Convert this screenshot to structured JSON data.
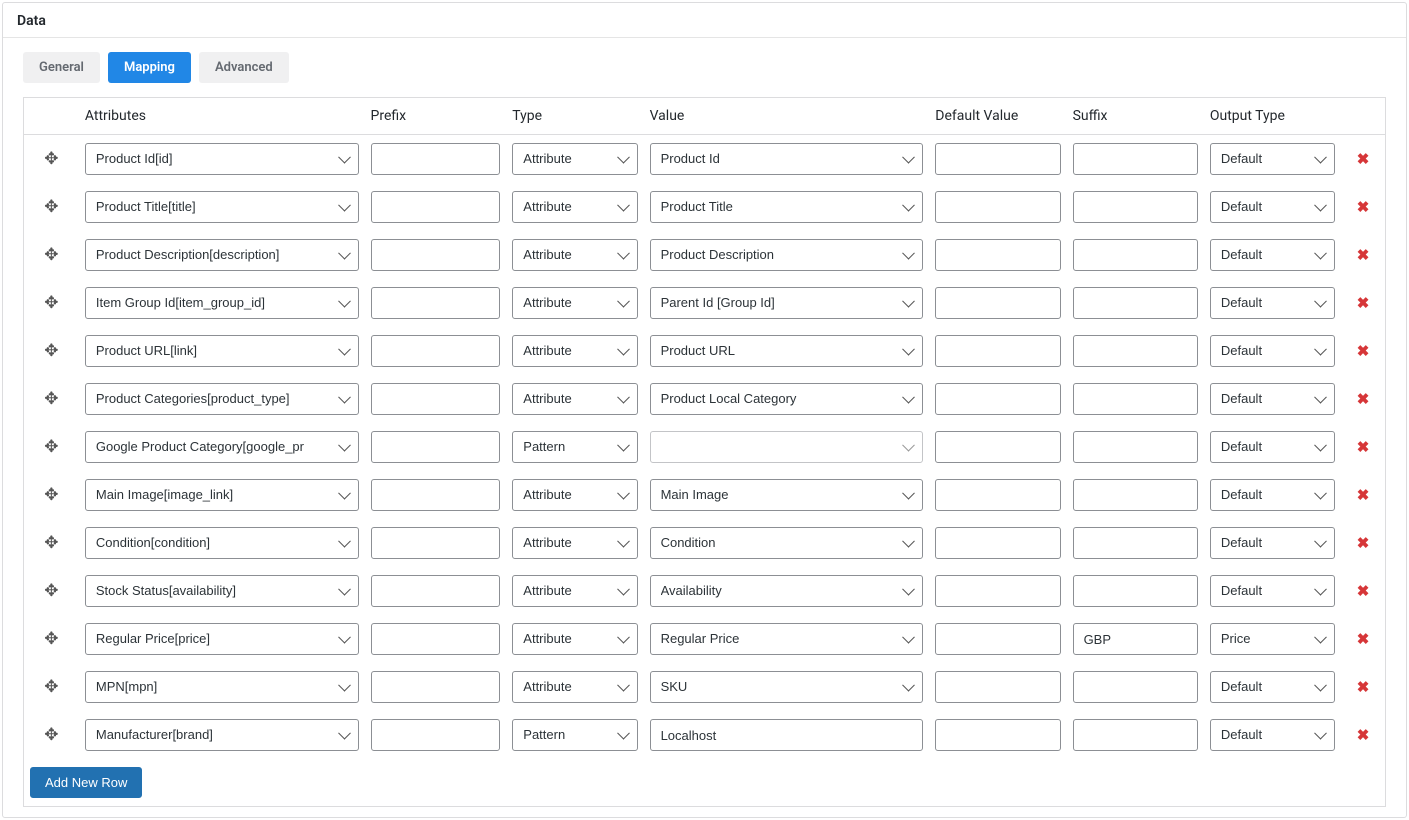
{
  "panel": {
    "title": "Data"
  },
  "tabs": [
    {
      "label": "General",
      "active": false
    },
    {
      "label": "Mapping",
      "active": true
    },
    {
      "label": "Advanced",
      "active": false
    }
  ],
  "headers": {
    "attributes": "Attributes",
    "prefix": "Prefix",
    "type": "Type",
    "value": "Value",
    "default_value": "Default Value",
    "suffix": "Suffix",
    "output_type": "Output Type"
  },
  "rows": [
    {
      "attribute": "Product Id[id]",
      "prefix": "",
      "type": "Attribute",
      "value": "Product Id",
      "value_kind": "select",
      "default": "",
      "suffix": "",
      "output": "Default"
    },
    {
      "attribute": "Product Title[title]",
      "prefix": "",
      "type": "Attribute",
      "value": "Product Title",
      "value_kind": "select",
      "default": "",
      "suffix": "",
      "output": "Default"
    },
    {
      "attribute": "Product Description[description]",
      "prefix": "",
      "type": "Attribute",
      "value": "Product Description",
      "value_kind": "select",
      "default": "",
      "suffix": "",
      "output": "Default"
    },
    {
      "attribute": "Item Group Id[item_group_id]",
      "prefix": "",
      "type": "Attribute",
      "value": "Parent Id [Group Id]",
      "value_kind": "select",
      "default": "",
      "suffix": "",
      "output": "Default"
    },
    {
      "attribute": "Product URL[link]",
      "prefix": "",
      "type": "Attribute",
      "value": "Product URL",
      "value_kind": "select",
      "default": "",
      "suffix": "",
      "output": "Default"
    },
    {
      "attribute": "Product Categories[product_type]",
      "prefix": "",
      "type": "Attribute",
      "value": "Product Local Category",
      "value_kind": "select",
      "default": "",
      "suffix": "",
      "output": "Default"
    },
    {
      "attribute": "Google Product Category[google_pr",
      "prefix": "",
      "type": "Pattern",
      "value": "",
      "value_kind": "select-light",
      "default": "",
      "suffix": "",
      "output": "Default"
    },
    {
      "attribute": "Main Image[image_link]",
      "prefix": "",
      "type": "Attribute",
      "value": "Main Image",
      "value_kind": "select",
      "default": "",
      "suffix": "",
      "output": "Default"
    },
    {
      "attribute": "Condition[condition]",
      "prefix": "",
      "type": "Attribute",
      "value": "Condition",
      "value_kind": "select",
      "default": "",
      "suffix": "",
      "output": "Default"
    },
    {
      "attribute": "Stock Status[availability]",
      "prefix": "",
      "type": "Attribute",
      "value": "Availability",
      "value_kind": "select",
      "default": "",
      "suffix": "",
      "output": "Default"
    },
    {
      "attribute": "Regular Price[price]",
      "prefix": "",
      "type": "Attribute",
      "value": "Regular Price",
      "value_kind": "select",
      "default": "",
      "suffix": "GBP",
      "output": "Price"
    },
    {
      "attribute": "MPN[mpn]",
      "prefix": "",
      "type": "Attribute",
      "value": "SKU",
      "value_kind": "select",
      "default": "",
      "suffix": "",
      "output": "Default"
    },
    {
      "attribute": "Manufacturer[brand]",
      "prefix": "",
      "type": "Pattern",
      "value": "Localhost",
      "value_kind": "text",
      "default": "",
      "suffix": "",
      "output": "Default"
    }
  ],
  "footer": {
    "add_row_label": "Add New Row"
  }
}
